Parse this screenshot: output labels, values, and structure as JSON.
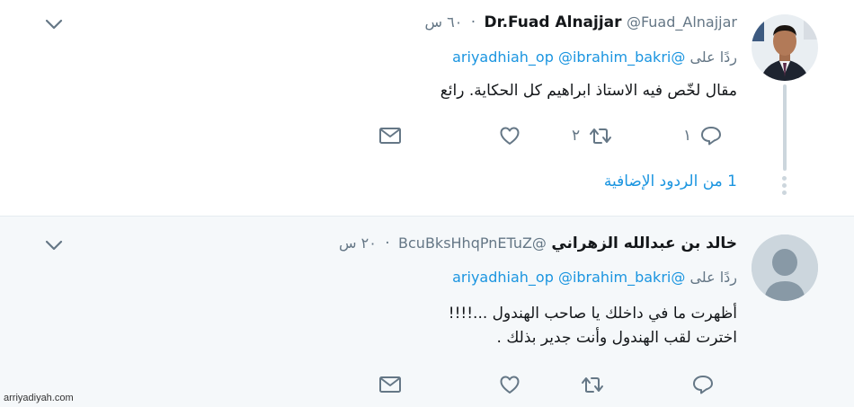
{
  "tweets": [
    {
      "name": "Dr.Fuad Alnajjar",
      "handle": "@Fuad_Alnajjar",
      "time": "٦٠ س",
      "reply_prefix": "ردًا على",
      "mentions": [
        "@ariyadhiah_op",
        "@ibrahim_bakri"
      ],
      "lines": [
        "مقال لخّص فيه الاستاذ ابراهيم كل الحكاية. رائع"
      ],
      "reply_count": "١",
      "retweet_count": "٢",
      "like_count": "",
      "more_replies": "1 من الردود الإضافية"
    },
    {
      "name": "خالد بن عبدالله الزهراني",
      "handle": "@BcuBksHhqPnETuZ",
      "time": "٢٠ س",
      "reply_prefix": "ردًا على",
      "mentions": [
        "@ariyadhiah_op",
        "@ibrahim_bakri"
      ],
      "lines": [
        "أظهرت ما في داخلك يا صاحب الهندول ...!!!!",
        "اخترت لقب الهندول وأنت جدير بذلك ."
      ],
      "reply_count": "",
      "retweet_count": "",
      "like_count": ""
    }
  ],
  "icons": {
    "reply": "reply-bubble-icon",
    "retweet": "retweet-icon",
    "like": "heart-icon",
    "dm": "envelope-icon",
    "caret": "chevron-down-icon"
  },
  "colors": {
    "link": "#1b95e0",
    "muted": "#657786",
    "text": "#14171a",
    "highlight_bg": "#f5f8fa"
  },
  "watermark": "arriyadiyah.com"
}
